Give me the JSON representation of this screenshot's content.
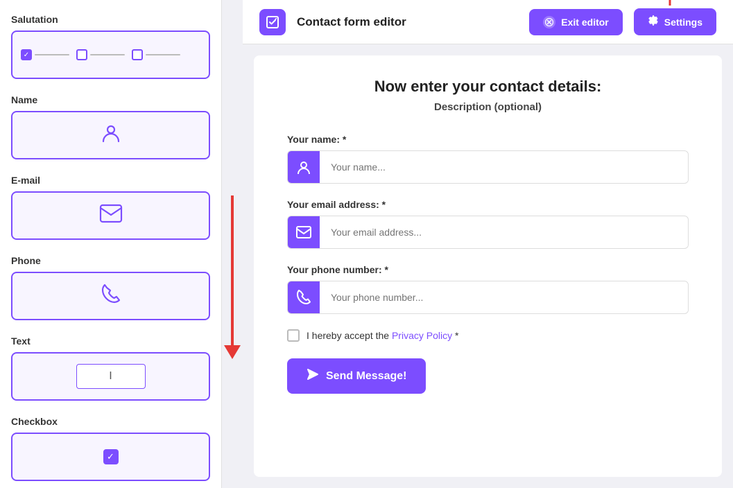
{
  "sidebar": {
    "sections": [
      {
        "id": "salutation",
        "label": "Salutation",
        "type": "salutation"
      },
      {
        "id": "name",
        "label": "Name",
        "type": "name"
      },
      {
        "id": "email",
        "label": "E-mail",
        "type": "email"
      },
      {
        "id": "phone",
        "label": "Phone",
        "type": "phone"
      },
      {
        "id": "text",
        "label": "Text",
        "type": "text"
      },
      {
        "id": "checkbox",
        "label": "Checkbox",
        "type": "checkbox"
      }
    ]
  },
  "topbar": {
    "title": "Contact form editor",
    "exit_label": "Exit editor",
    "settings_label": "Settings"
  },
  "form": {
    "title": "Now enter your contact details:",
    "description": "Description (optional)",
    "fields": [
      {
        "label": "Your name: *",
        "placeholder": "Your name...",
        "type": "name",
        "icon": "person"
      },
      {
        "label": "Your email address: *",
        "placeholder": "Your email address...",
        "type": "email",
        "icon": "email"
      },
      {
        "label": "Your phone number: *",
        "placeholder": "Your phone number...",
        "type": "phone",
        "icon": "phone"
      }
    ],
    "checkbox_label_pre": "I hereby accept the ",
    "privacy_link_label": "Privacy Policy",
    "checkbox_label_post": " *",
    "send_button_label": "Send Message!"
  },
  "colors": {
    "primary": "#7c4dff",
    "danger": "#e53935"
  }
}
